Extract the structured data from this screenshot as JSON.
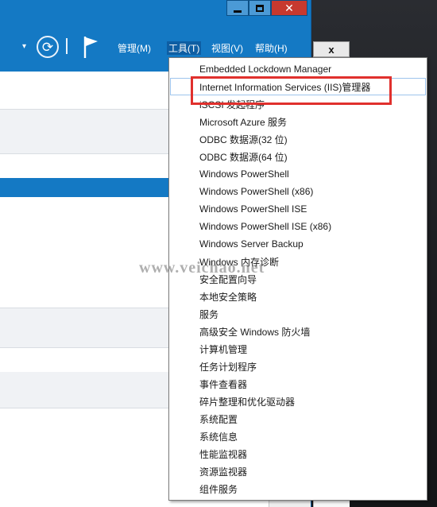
{
  "window": {
    "minimize_icon": "minimize-icon",
    "maximize_icon": "maximize-icon",
    "close_glyph": "✕",
    "accent": "#1479c4",
    "close_color": "#c7392f"
  },
  "toolbar": {
    "dropdown_glyph": "▾",
    "refresh_glyph": "⟳",
    "flag_icon": "flag-icon"
  },
  "menubar": {
    "manage": "管理(M)",
    "tools": "工具(T)",
    "view": "视图(V)",
    "help": "帮助(H)"
  },
  "side_panel": {
    "close_glyph": "x"
  },
  "tools_menu": {
    "items": [
      "Embedded Lockdown Manager",
      "Internet Information Services (IIS)管理器",
      "iSCSI 发起程序",
      "Microsoft Azure 服务",
      "ODBC 数据源(32 位)",
      "ODBC 数据源(64 位)",
      "Windows PowerShell",
      "Windows PowerShell (x86)",
      "Windows PowerShell ISE",
      "Windows PowerShell ISE (x86)",
      "Windows Server Backup",
      "Windows 内存诊断",
      "安全配置向导",
      "本地安全策略",
      "服务",
      "高级安全 Windows 防火墙",
      "计算机管理",
      "任务计划程序",
      "事件查看器",
      "碎片整理和优化驱动器",
      "系统配置",
      "系统信息",
      "性能监视器",
      "资源监视器",
      "组件服务"
    ],
    "highlighted_index": 1,
    "annotation_color": "#e0302d"
  },
  "watermark": "www.veichao.net"
}
